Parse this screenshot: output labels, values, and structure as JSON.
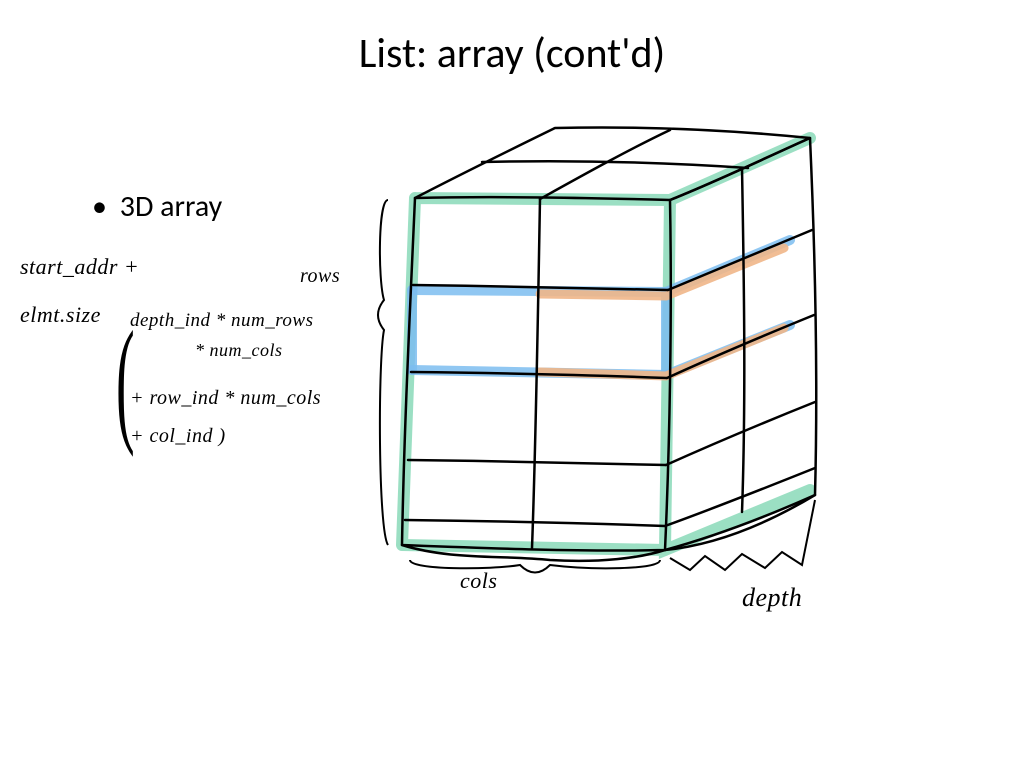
{
  "title": "List: array (cont'd)",
  "bullet": "3D array",
  "formula": {
    "line1": "start_addr +",
    "line2": "elmt.size",
    "line3": "depth_ind * num_rows",
    "line4": "* num_cols",
    "line5": "+ row_ind * num_cols",
    "line6": "+ col_ind )"
  },
  "labels": {
    "rows": "rows",
    "cols": "cols",
    "depth": "depth"
  },
  "colors": {
    "green": "#8ad9b8",
    "blue": "#7cbdf0",
    "orange": "#f0b688",
    "ink": "#000000"
  }
}
